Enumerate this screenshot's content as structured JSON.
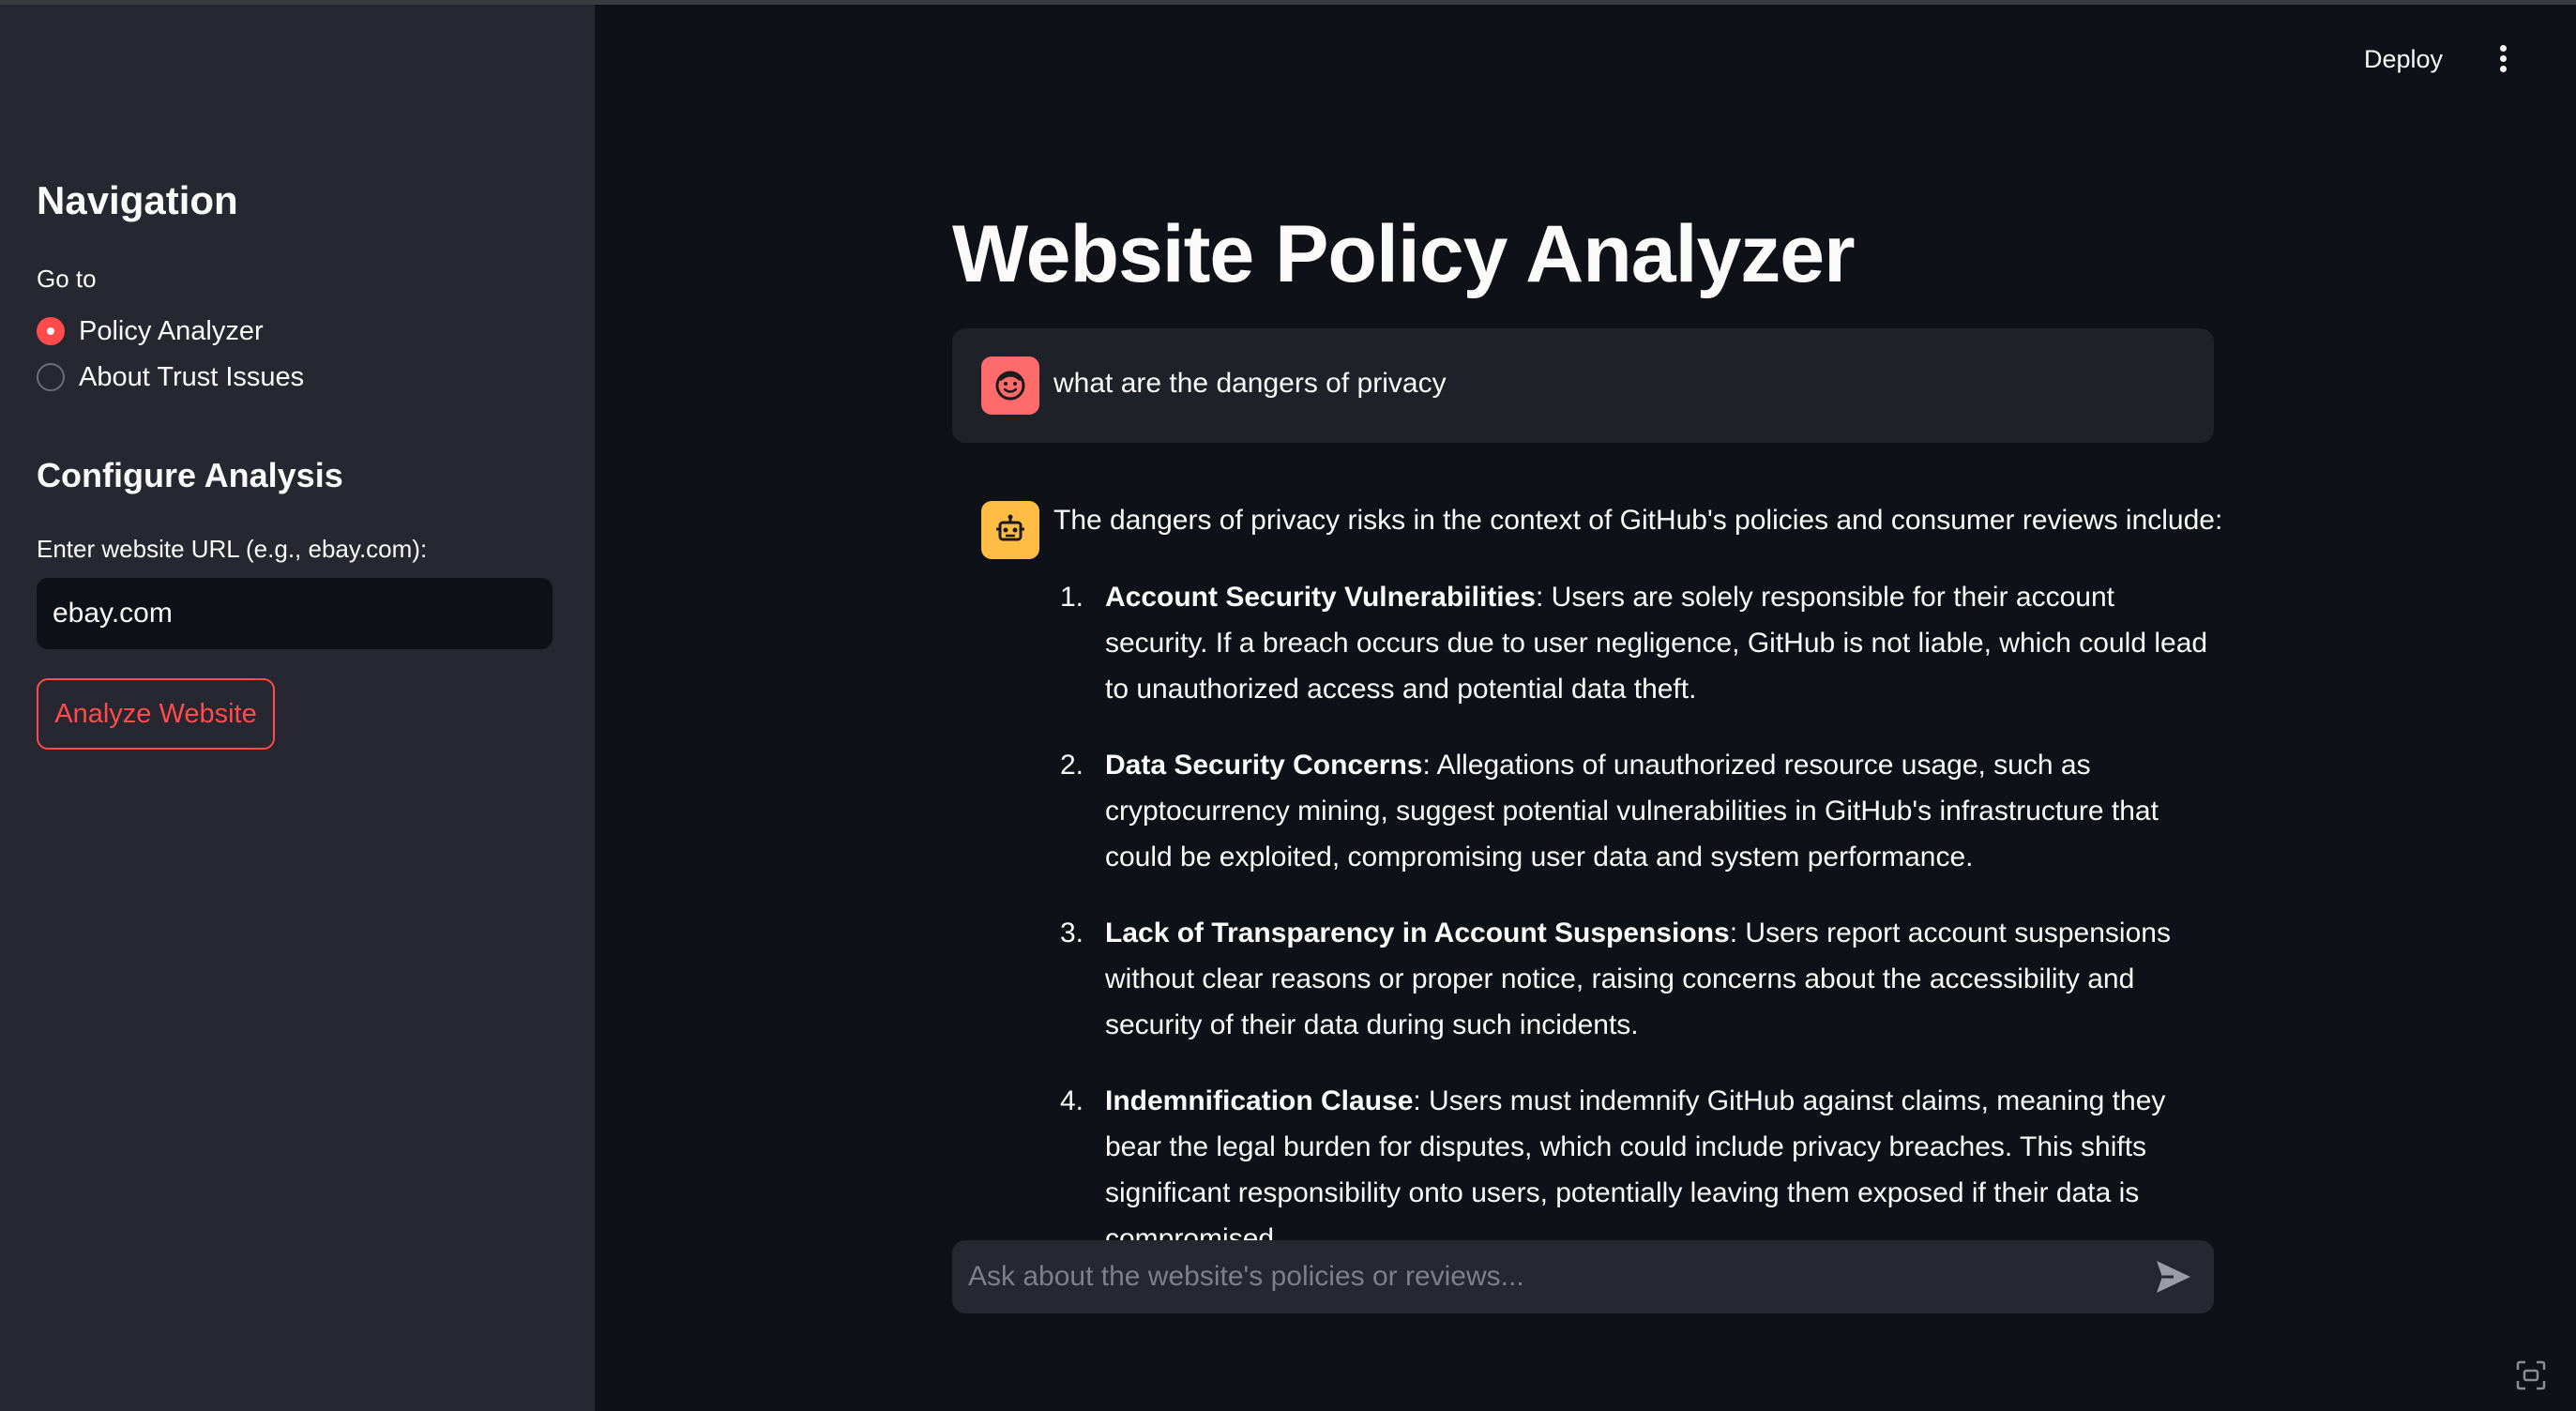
{
  "sidebar": {
    "nav_heading": "Navigation",
    "goto_label": "Go to",
    "options": [
      {
        "label": "Policy Analyzer",
        "selected": true
      },
      {
        "label": "About Trust Issues",
        "selected": false
      }
    ],
    "config_heading": "Configure Analysis",
    "url_label": "Enter website URL (e.g., ebay.com):",
    "url_value": "ebay.com",
    "analyze_button": "Analyze Website"
  },
  "header": {
    "deploy_label": "Deploy",
    "menu_icon": "kebab-menu-icon"
  },
  "main": {
    "title": "Website Policy Analyzer",
    "user_message": "what are the dangers of privacy",
    "user_avatar_icon": "smiley-face-icon",
    "bot_avatar_icon": "robot-icon",
    "bot_intro": "The dangers of privacy risks in the context of GitHub's policies and consumer reviews include:",
    "bot_items": [
      {
        "num": "1.",
        "title": "Account Security Vulnerabilities",
        "text": ": Users are solely responsible for their account security. If a breach occurs due to user negligence, GitHub is not liable, which could lead to unauthorized access and potential data theft."
      },
      {
        "num": "2.",
        "title": "Data Security Concerns",
        "text": ": Allegations of unauthorized resource usage, such as cryptocurrency mining, suggest potential vulnerabilities in GitHub's infrastructure that could be exploited, compromising user data and system performance."
      },
      {
        "num": "3.",
        "title": "Lack of Transparency in Account Suspensions",
        "text": ": Users report account suspensions without clear reasons or proper notice, raising concerns about the accessibility and security of their data during such incidents."
      },
      {
        "num": "4.",
        "title": "Indemnification Clause",
        "text": ": Users must indemnify GitHub against claims, meaning they bear the legal burden for disputes, which could include privacy breaches. This shifts significant responsibility onto users, potentially leaving them exposed if their data is compromised."
      }
    ],
    "chat_placeholder": "Ask about the website's policies or reviews..."
  },
  "colors": {
    "accent": "#ff4b4b",
    "background": "#0e1117",
    "sidebar": "#262730",
    "user_avatar": "#ff6b6b",
    "bot_avatar": "#ffbd45"
  }
}
